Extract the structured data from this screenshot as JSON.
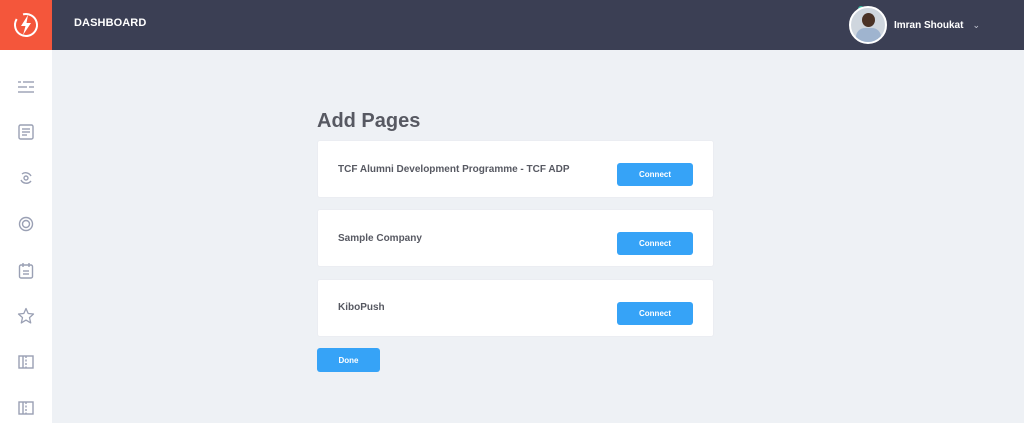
{
  "app": {
    "logo_icon": "lightning-bolt-icon",
    "brand_color": "#f4563b",
    "accent_color": "#36a3f7"
  },
  "header": {
    "title": "DASHBOARD",
    "user": {
      "name": "Imran Shoukat",
      "menu_icon": "chevron-down-icon",
      "online": true
    }
  },
  "sidebar": {
    "items": [
      {
        "icon": "menu-list-icon"
      },
      {
        "icon": "document-icon"
      },
      {
        "icon": "refresh-cycle-icon"
      },
      {
        "icon": "target-circle-icon"
      },
      {
        "icon": "calendar-icon"
      },
      {
        "icon": "star-icon"
      },
      {
        "icon": "layout-icon"
      },
      {
        "icon": "layout-icon"
      }
    ]
  },
  "main": {
    "heading": "Add Pages",
    "pages": [
      {
        "name": "TCF Alumni Development Programme - TCF ADP",
        "button_label": "Connect"
      },
      {
        "name": "Sample Company",
        "button_label": "Connect"
      },
      {
        "name": "KiboPush",
        "button_label": "Connect"
      }
    ],
    "done_label": "Done"
  }
}
